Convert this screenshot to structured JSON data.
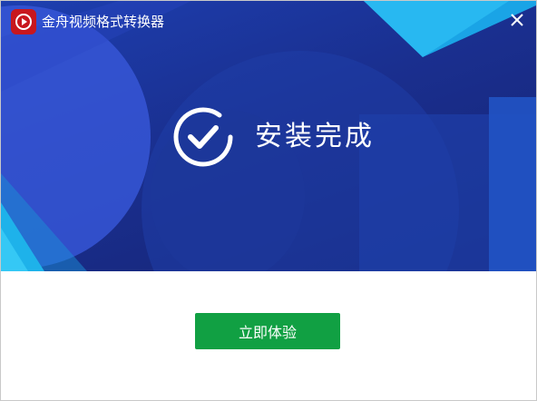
{
  "window": {
    "title": "金舟视频格式转换器",
    "logo_icon": "play-logo-icon",
    "close_icon": "close-icon"
  },
  "hero": {
    "status_icon": "check-circle-icon",
    "status_text": "安装完成"
  },
  "actions": {
    "primary_label": "立即体验"
  },
  "colors": {
    "hero_background": "#1a2f8f",
    "logo_red": "#c8171e",
    "primary_button": "#11a043"
  }
}
